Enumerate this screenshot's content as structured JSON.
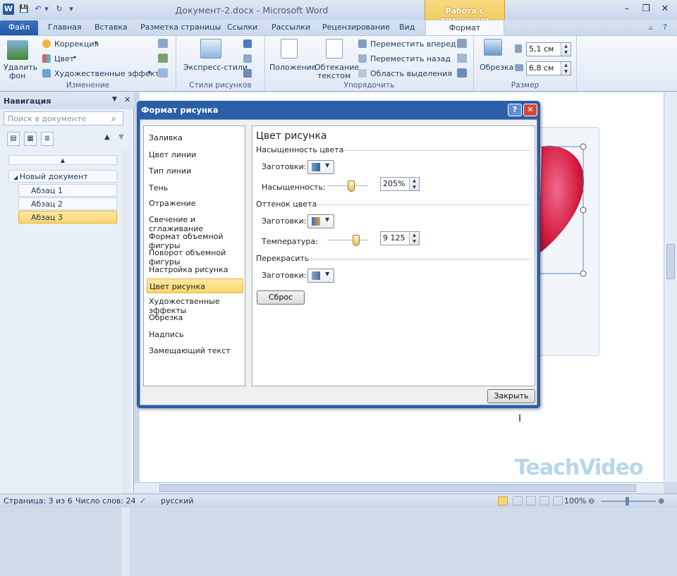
{
  "window": {
    "title": "Документ-2.docx - Microsoft Word",
    "context_tab_group": "Работа с рисунками",
    "minimize": "–",
    "restore": "❐",
    "close": "✕"
  },
  "qat": {
    "word_icon": "W",
    "save": "💾",
    "undo": "↶",
    "undo_drop": "▾",
    "redo": "↻",
    "customize": "▾"
  },
  "tabs": {
    "file": "Файл",
    "items": [
      "Главная",
      "Вставка",
      "Разметка страницы",
      "Ссылки",
      "Рассылки",
      "Рецензирование",
      "Вид"
    ],
    "format": "Формат"
  },
  "ribbon": {
    "adjust": {
      "remove_bg_1": "Удалить",
      "remove_bg_2": "фон",
      "correction": "Коррекция",
      "color": "Цвет",
      "art_effects": "Художественные эффекты",
      "label": "Изменение"
    },
    "styles": {
      "quick_styles": "Экспресс-стили",
      "label": "Стили рисунков"
    },
    "arrange": {
      "position": "Положение",
      "wrap_1": "Обтекание",
      "wrap_2": "текстом",
      "bring_forward": "Переместить вперед",
      "send_backward": "Переместить назад",
      "selection_pane": "Область выделения",
      "label": "Упорядочить"
    },
    "size": {
      "crop": "Обрезка",
      "height": "5,1 см",
      "width": "6,8 см",
      "label": "Размер"
    }
  },
  "nav": {
    "title": "Навигация",
    "search_placeholder": "Поиск в документе",
    "items": [
      {
        "label": "Новый документ"
      },
      {
        "label": "Абзац 1"
      },
      {
        "label": "Абзац 2"
      },
      {
        "label": "Абзац 3"
      }
    ]
  },
  "dialog": {
    "title": "Формат рисунка",
    "help": "?",
    "close_x": "✕",
    "categories": [
      "Заливка",
      "Цвет линии",
      "Тип линии",
      "Тень",
      "Отражение",
      "Свечение и сглаживание",
      "Формат объемной фигуры",
      "Поворот объемной фигуры",
      "Настройка рисунка",
      "Цвет рисунка",
      "Художественные эффекты",
      "Обрезка",
      "Надпись",
      "Замещающий текст"
    ],
    "selected": "Цвет рисунка",
    "panel": {
      "heading": "Цвет рисунка",
      "saturation_section": "Насыщенность цвета",
      "presets_label": "Заготовки:",
      "saturation_label": "Насыщенность:",
      "saturation_value": "205%",
      "saturation_level": 0.6,
      "tone_section": "Оттенок цвета",
      "temperature_label": "Температура:",
      "temperature_value": "9 125",
      "temperature_level": 0.75,
      "recolor_section": "Перекрасить",
      "reset": "Сброс"
    },
    "close_button": "Закрыть"
  },
  "status": {
    "page": "Страница: 3 из 6",
    "words": "Число слов: 24",
    "language": "русский",
    "zoom": "100%"
  },
  "watermark": "TeachVideo",
  "colors": {
    "accent": "#2a5ea8",
    "context_tab": "#f0c24a",
    "selection": "#f9d66a"
  }
}
